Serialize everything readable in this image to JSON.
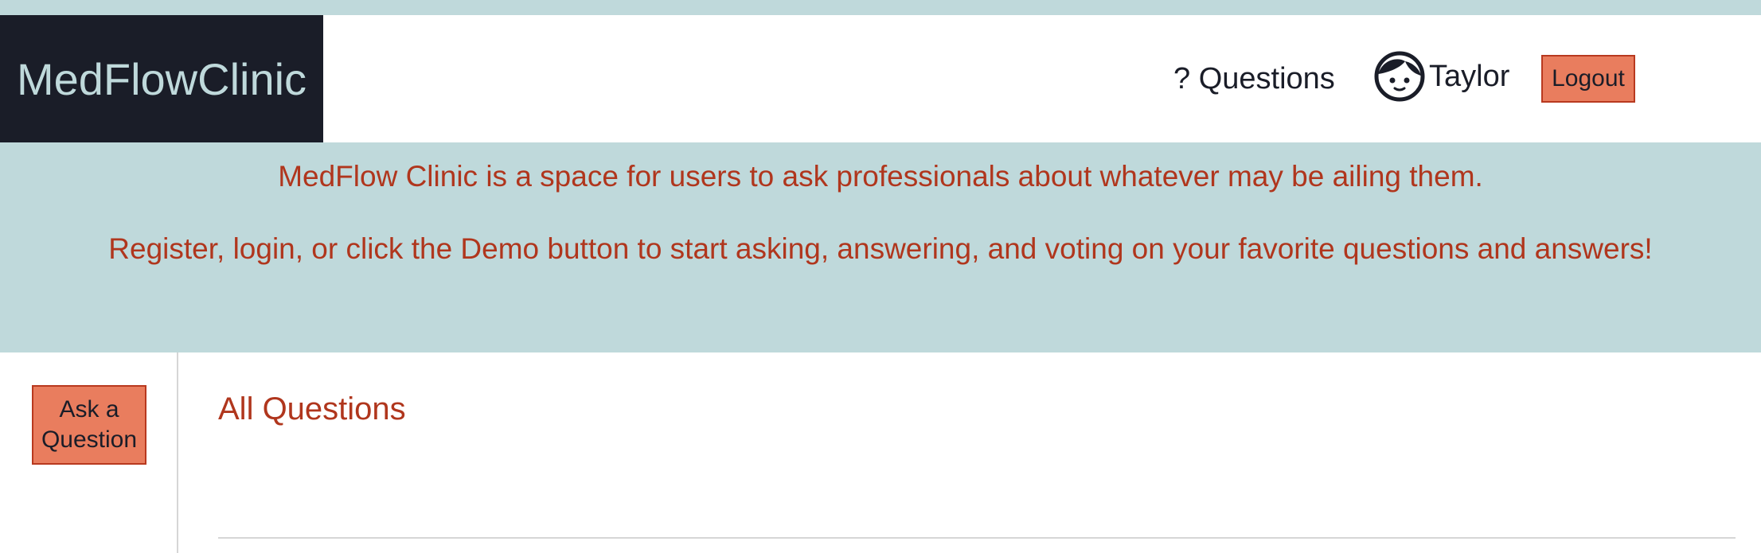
{
  "header": {
    "logo_text": "MedFlowClinic",
    "nav_questions_label": "? Questions",
    "user_name": "Taylor",
    "logout_label": "Logout"
  },
  "banner": {
    "line1": "MedFlow Clinic is a space for users to ask professionals about whatever may be ailing them.",
    "line2": "Register, login, or click the Demo button to start asking, answering, and voting on your favorite questions and answers!"
  },
  "sidebar": {
    "ask_button_label": "Ask a Question"
  },
  "main": {
    "title": "All Questions"
  },
  "colors": {
    "accent_bg": "#bfd9db",
    "logo_bg": "#1a1d28",
    "button_bg": "#e97d5e",
    "button_border": "#b8391f",
    "accent_text": "#b0361d"
  },
  "icons": {
    "user_avatar": "face-icon"
  }
}
